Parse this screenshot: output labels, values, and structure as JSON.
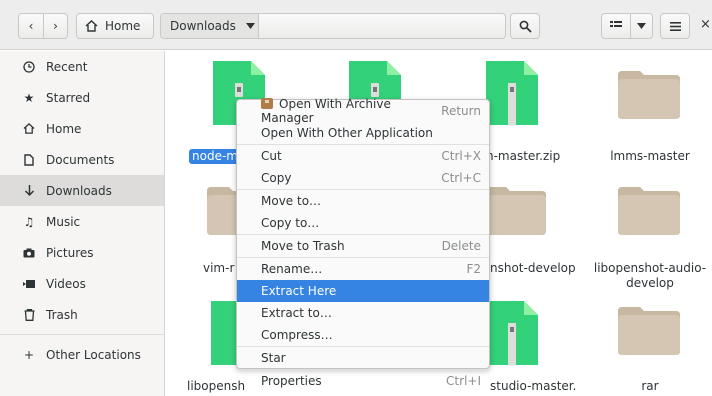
{
  "header": {
    "home_label": "Home",
    "current_folder": "Downloads",
    "close_glyph": "×"
  },
  "sidebar": {
    "items": [
      {
        "label": "Recent",
        "icon": "clock-icon"
      },
      {
        "label": "Starred",
        "icon": "star-icon"
      },
      {
        "label": "Home",
        "icon": "home-icon"
      },
      {
        "label": "Documents",
        "icon": "document-icon"
      },
      {
        "label": "Downloads",
        "icon": "download-icon",
        "active": true
      },
      {
        "label": "Music",
        "icon": "music-icon"
      },
      {
        "label": "Pictures",
        "icon": "camera-icon"
      },
      {
        "label": "Videos",
        "icon": "video-icon"
      },
      {
        "label": "Trash",
        "icon": "trash-icon"
      }
    ],
    "other_locations": "Other Locations"
  },
  "files": [
    {
      "label": "node-m",
      "type": "zip",
      "selected": true
    },
    {
      "label": "",
      "type": "zip"
    },
    {
      "label": "n-master.zip",
      "type": "zip"
    },
    {
      "label": "lmms-master",
      "type": "folder"
    },
    {
      "label": "vim-r",
      "type": "folder"
    },
    {
      "label": "",
      "type": "folder"
    },
    {
      "label": "nshot-develop",
      "type": "folder"
    },
    {
      "label": "libopenshot-audio-develop",
      "type": "folder"
    },
    {
      "label": "libopensh",
      "type": "zip"
    },
    {
      "label": "",
      "type": "zip"
    },
    {
      "label": "studio-master.",
      "type": "zip"
    },
    {
      "label": "rar",
      "type": "folder"
    }
  ],
  "context_menu": {
    "items": [
      {
        "label": "Open With Archive Manager",
        "accel": "Return",
        "icon": "archive-icon"
      },
      {
        "label": "Open With Other Application",
        "accel": ""
      },
      {
        "label": "Cut",
        "accel": "Ctrl+X"
      },
      {
        "label": "Copy",
        "accel": "Ctrl+C"
      },
      {
        "label": "Move to…",
        "accel": ""
      },
      {
        "label": "Copy to…",
        "accel": ""
      },
      {
        "label": "Move to Trash",
        "accel": "Delete"
      },
      {
        "label": "Rename…",
        "accel": "F2"
      },
      {
        "label": "Extract Here",
        "accel": "",
        "highlighted": true
      },
      {
        "label": "Extract to…",
        "accel": ""
      },
      {
        "label": "Compress…",
        "accel": ""
      },
      {
        "label": "Star",
        "accel": ""
      },
      {
        "label": "Properties",
        "accel": "Ctrl+I"
      }
    ]
  },
  "colors": {
    "accent": "#3584e4",
    "zip_green": "#33d17a",
    "folder_tan": "#d5c6b3"
  }
}
